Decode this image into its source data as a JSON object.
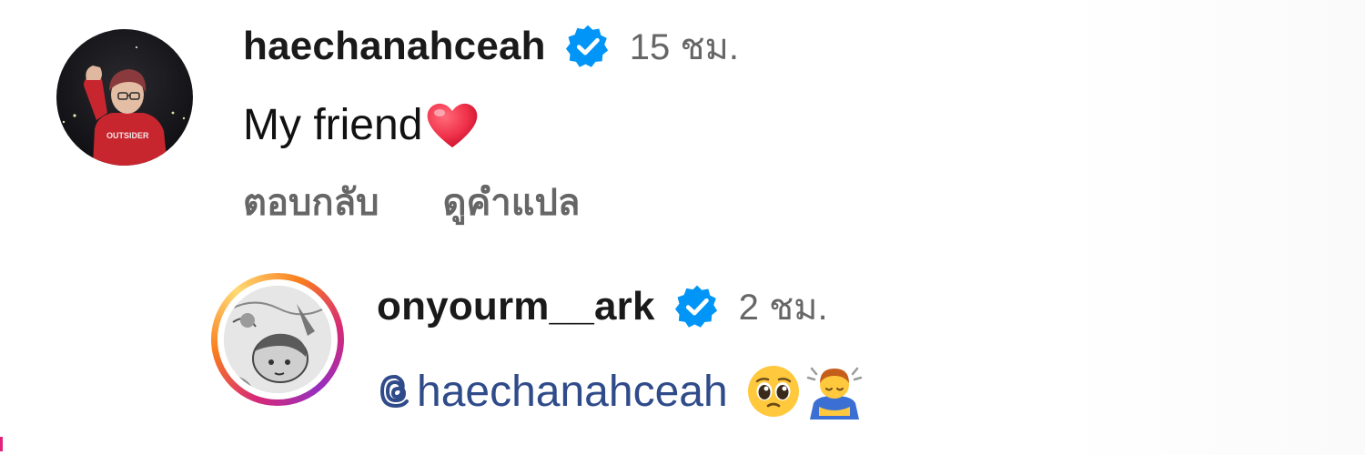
{
  "comments": [
    {
      "username": "haechanahceah",
      "timestamp": "15 ชม.",
      "text": "My friend",
      "text_emoji": "heart",
      "actions": [
        "ตอบกลับ",
        "ดูคำแปล"
      ]
    },
    {
      "username": "onyourm__ark",
      "timestamp": "2 ชม.",
      "mention": "haechanahceah",
      "emojis": [
        "pleading-face-emoji",
        "person-bowing-emoji"
      ]
    }
  ],
  "colors": {
    "verified_badge": "#0095f6",
    "mention": "#304b8a",
    "timestamp": "#666666",
    "heart": "#f0324a",
    "story_ring": "#d62976"
  },
  "icons": {
    "verified": "verified-badge-icon",
    "threads": "threads-icon",
    "heart": "red-heart-emoji"
  }
}
